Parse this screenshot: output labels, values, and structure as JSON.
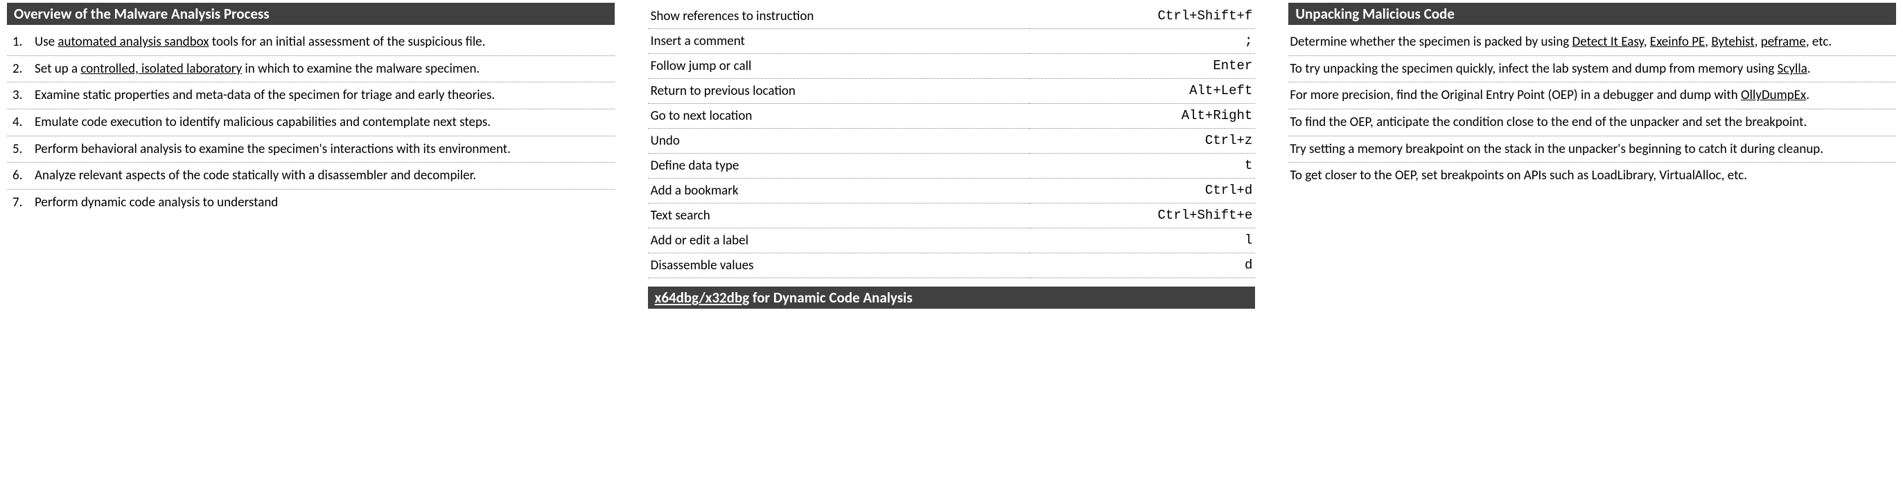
{
  "col1": {
    "heading": "Overview of the Malware Analysis Process",
    "items": [
      {
        "pre": "Use ",
        "link": "automated analysis sandbox",
        "post": " tools for an initial assessment of the suspicious file."
      },
      {
        "pre": "Set up a ",
        "link": "controlled, isolated laboratory",
        "post": " in which to examine the malware specimen."
      },
      {
        "pre": "Examine static properties and meta-data of the specimen for triage and early theories.",
        "link": "",
        "post": ""
      },
      {
        "pre": "Emulate code execution to identify malicious capabilities and contemplate next steps.",
        "link": "",
        "post": ""
      },
      {
        "pre": "Perform behavioral analysis to examine the specimen's interactions with its environment.",
        "link": "",
        "post": ""
      },
      {
        "pre": "Analyze relevant aspects of the code statically with a disassembler and decompiler.",
        "link": "",
        "post": ""
      },
      {
        "pre": "Perform dynamic code analysis to understand",
        "link": "",
        "post": ""
      }
    ]
  },
  "col2": {
    "shortcuts": [
      {
        "desc": "Show references to instruction",
        "key": "Ctrl+Shift+f"
      },
      {
        "desc": "Insert a comment",
        "key": ";"
      },
      {
        "desc": "Follow jump or call",
        "key": "Enter"
      },
      {
        "desc": "Return to previous location",
        "key": "Alt+Left"
      },
      {
        "desc": "Go to next location",
        "key": "Alt+Right"
      },
      {
        "desc": "Undo",
        "key": "Ctrl+z"
      },
      {
        "desc": "Define data type",
        "key": "t"
      },
      {
        "desc": "Add a bookmark",
        "key": "Ctrl+d"
      },
      {
        "desc": "Text search",
        "key": "Ctrl+Shift+e"
      },
      {
        "desc": "Add or edit a label",
        "key": "l"
      },
      {
        "desc": "Disassemble values",
        "key": "d"
      }
    ],
    "heading2_link": "x64dbg/x32dbg",
    "heading2_rest": " for Dynamic Code Analysis"
  },
  "col3": {
    "heading": "Unpacking Malicious Code",
    "para1_pre": "Determine whether the specimen is packed by using ",
    "para1_links": [
      "Detect It Easy",
      "Exeinfo PE",
      "Bytehist",
      "peframe"
    ],
    "para1_post": ", etc.",
    "para2_pre": "To try unpacking the specimen quickly, infect the lab system and dump from memory using ",
    "para2_link": "Scylla",
    "para2_post": ".",
    "para3_pre": "For more precision, find the Original Entry Point (OEP) in a debugger and dump with ",
    "para3_link": "OllyDumpEx",
    "para3_post": ".",
    "para4": "To find the OEP, anticipate the condition close to the end of the unpacker and set the breakpoint.",
    "para5": "Try setting a memory breakpoint on the stack in the unpacker's beginning to catch it during cleanup.",
    "para6": "To get closer to the OEP, set breakpoints on APIs such as LoadLibrary, VirtualAlloc, etc."
  }
}
